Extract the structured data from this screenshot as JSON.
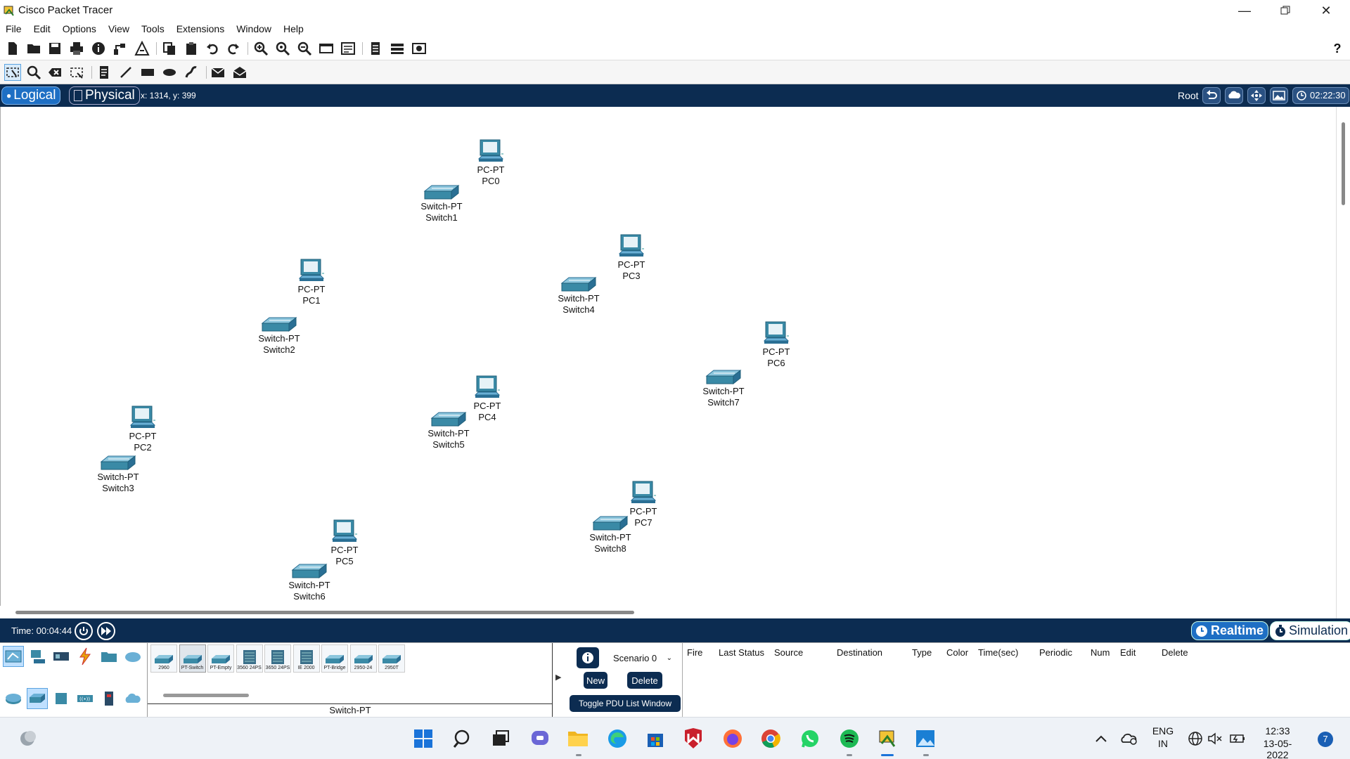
{
  "window": {
    "title": "Cisco Packet Tracer"
  },
  "menu": [
    "File",
    "Edit",
    "Options",
    "View",
    "Tools",
    "Extensions",
    "Window",
    "Help"
  ],
  "workspace": {
    "logical_label": "Logical",
    "physical_label": "Physical",
    "coords": "x: 1314, y: 399",
    "root_label": "Root",
    "clock": "02:22:30"
  },
  "devices": [
    {
      "type": "PC-PT",
      "name": "PC0",
      "kind": "pc"
    },
    {
      "type": "Switch-PT",
      "name": "Switch1",
      "kind": "switch"
    },
    {
      "type": "PC-PT",
      "name": "PC3",
      "kind": "pc"
    },
    {
      "type": "Switch-PT",
      "name": "Switch4",
      "kind": "switch"
    },
    {
      "type": "PC-PT",
      "name": "PC1",
      "kind": "pc"
    },
    {
      "type": "Switch-PT",
      "name": "Switch2",
      "kind": "switch"
    },
    {
      "type": "PC-PT",
      "name": "PC6",
      "kind": "pc"
    },
    {
      "type": "Switch-PT",
      "name": "Switch7",
      "kind": "switch"
    },
    {
      "type": "PC-PT",
      "name": "PC4",
      "kind": "pc"
    },
    {
      "type": "Switch-PT",
      "name": "Switch5",
      "kind": "switch"
    },
    {
      "type": "PC-PT",
      "name": "PC2",
      "kind": "pc"
    },
    {
      "type": "Switch-PT",
      "name": "Switch3",
      "kind": "switch"
    },
    {
      "type": "PC-PT",
      "name": "PC7",
      "kind": "pc"
    },
    {
      "type": "Switch-PT",
      "name": "Switch8",
      "kind": "switch"
    },
    {
      "type": "PC-PT",
      "name": "PC5",
      "kind": "pc"
    },
    {
      "type": "Switch-PT",
      "name": "Switch6",
      "kind": "switch"
    }
  ],
  "timebar": {
    "time": "Time: 00:04:44",
    "realtime_label": "Realtime",
    "simulation_label": "Simulation"
  },
  "device_models": [
    "2960",
    "PT-Switch",
    "PT-Empty",
    "3560 24PS",
    "3650 24PS",
    "IE 2000",
    "PT-Bridge",
    "2950-24",
    "2950T"
  ],
  "selected_device_name": "Switch-PT",
  "pdu": {
    "scenario": "Scenario 0",
    "new_label": "New",
    "delete_label": "Delete",
    "toggle_label": "Toggle PDU List Window",
    "columns": [
      "Fire",
      "Last Status",
      "Source",
      "Destination",
      "Type",
      "Color",
      "Time(sec)",
      "Periodic",
      "Num",
      "Edit",
      "Delete"
    ]
  },
  "taskbar": {
    "lang_top": "ENG",
    "lang_bottom": "IN",
    "time": "12:33",
    "date": "13-05-2022",
    "notifications": "7"
  },
  "colors": {
    "accent": "#0c2c51",
    "active_tab": "#1e6fc4",
    "device_teal": "#3a8aa6"
  }
}
